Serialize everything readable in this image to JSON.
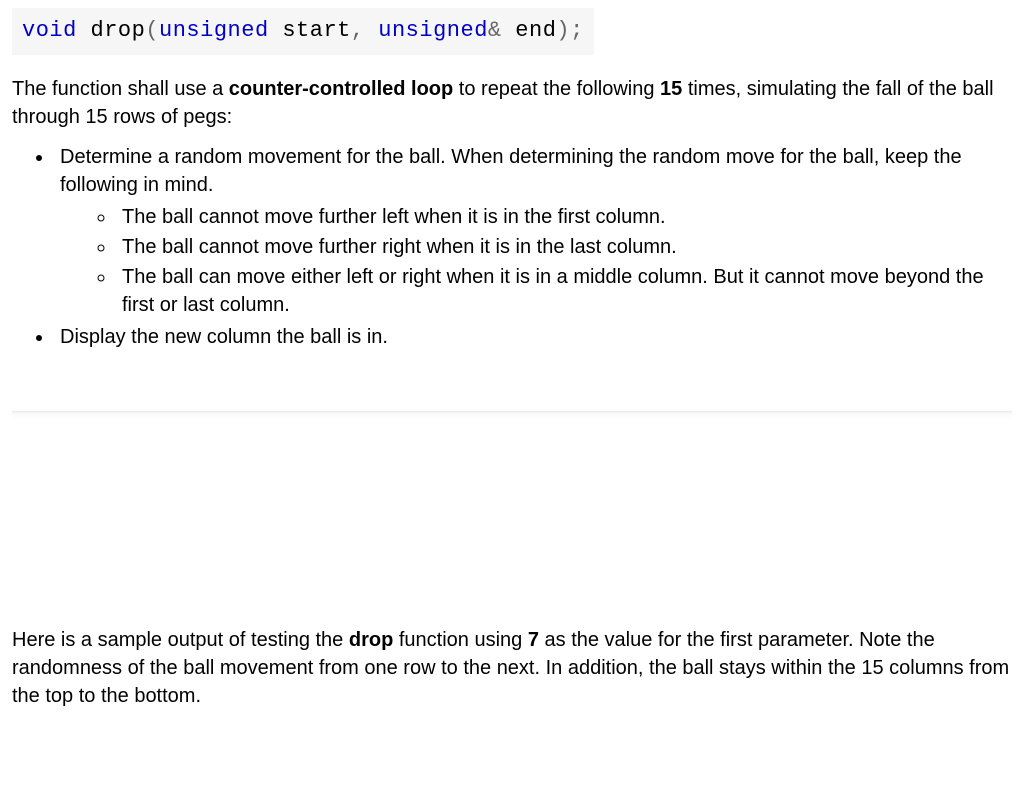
{
  "code": {
    "kw_void": "void",
    "fn_name": "drop",
    "lparen": "(",
    "ty_unsigned_1": "unsigned",
    "param1": " start",
    "comma": ", ",
    "ty_unsigned_2": "unsigned",
    "amp": "&",
    "param2": " end",
    "rparen_semi": ");"
  },
  "intro_before_bold1": "The function shall use a ",
  "intro_bold1": "counter-controlled loop",
  "intro_between": " to repeat the following ",
  "intro_bold2": "15",
  "intro_after": " times, simulating the fall of the ball through 15 rows of pegs:",
  "bullets": {
    "b1": "Determine a random movement for the ball. When determining the random move for the ball, keep the following in mind.",
    "b1_sub": {
      "s1": "The ball cannot move further left when it is in the first column.",
      "s2": "The ball cannot move further right when it is in the last column.",
      "s3": "The ball can move either left or right when it is in a middle column. But it cannot move beyond the first or last column."
    },
    "b2": "Display the new column the ball is in."
  },
  "sample_before_bold1": "Here is a sample output of testing the ",
  "sample_bold1": "drop",
  "sample_between": " function using ",
  "sample_bold2": "7",
  "sample_after": " as the value for the first parameter. Note the randomness of the ball movement from one row to the next. In addition, the ball stays within the 15 columns from the top to the bottom."
}
